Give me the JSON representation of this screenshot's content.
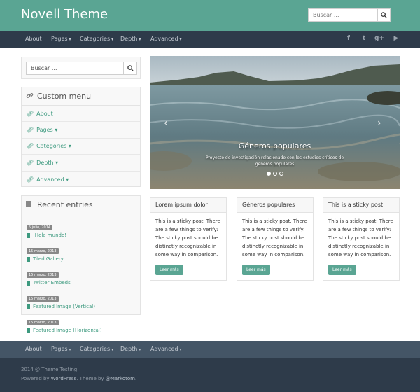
{
  "header": {
    "site_title": "Novell Theme",
    "search_placeholder": "Buscar ..."
  },
  "nav": {
    "items": [
      {
        "label": "About",
        "has_caret": false
      },
      {
        "label": "Pages",
        "has_caret": true
      },
      {
        "label": "Categories",
        "has_caret": true
      },
      {
        "label": "Depth",
        "has_caret": true
      },
      {
        "label": "Advanced",
        "has_caret": true
      }
    ],
    "caret": "▾",
    "social": [
      {
        "icon": "facebook-icon",
        "glyph": "f"
      },
      {
        "icon": "twitter-icon",
        "glyph": "t"
      },
      {
        "icon": "google-plus-icon",
        "glyph": "g+"
      },
      {
        "icon": "youtube-icon",
        "glyph": "▶"
      }
    ]
  },
  "sidebar": {
    "search_placeholder": "Buscar ...",
    "menu_title": "Custom menu",
    "menu_items": [
      {
        "label": "About"
      },
      {
        "label": "Pages ▾"
      },
      {
        "label": "Categories ▾"
      },
      {
        "label": "Depth ▾"
      },
      {
        "label": "Advanced ▾"
      }
    ],
    "recent_title": "Recent entries",
    "recent": [
      {
        "date": "5 julio, 2014",
        "title": "¡Hola mundo!"
      },
      {
        "date": "15 marzo, 2013",
        "title": "Tiled Gallery"
      },
      {
        "date": "15 marzo, 2013",
        "title": "Twitter Embeds"
      },
      {
        "date": "15 marzo, 2013",
        "title": "Featured Image (Vertical)"
      },
      {
        "date": "15 marzo, 2013",
        "title": "Featured Image (Horizontal)"
      }
    ]
  },
  "slider": {
    "title": "Géneros populares",
    "caption": "Proyecto de investigación relacionado con los estudios críticos de géneros populares",
    "prev": "‹",
    "next": "›",
    "active_slide": 1,
    "slide_count": 3
  },
  "cards": [
    {
      "title": "Lorem ipsum dolor",
      "body": "This is a sticky post. There are a few things to verify: The sticky post should be distinctly recognizable in some way in comparison.",
      "button": "Leer más"
    },
    {
      "title": "Géneros populares",
      "body": "This is a sticky post. There are a few things to verify: The sticky post should be distinctly recognizable in some way in comparison.",
      "button": "Leer más"
    },
    {
      "title": "This is a sticky post",
      "body": "This is a sticky post. There are a few things to verify: The sticky post should be distinctly recognizable in some way in comparison.",
      "button": "Leer más"
    }
  ],
  "footer": {
    "copyright": "2014 @ Theme Testing.",
    "powered_prefix": "Powered by ",
    "powered_link": "WordPress",
    "theme_mid": ". Theme by ",
    "theme_link": "@Markotom",
    "theme_end": "."
  },
  "colors": {
    "header": "#5aa593",
    "nav": "#2e3b4a",
    "footer_nav": "#445566",
    "footer": "#2e3b4a",
    "link": "#3d9a7f"
  }
}
